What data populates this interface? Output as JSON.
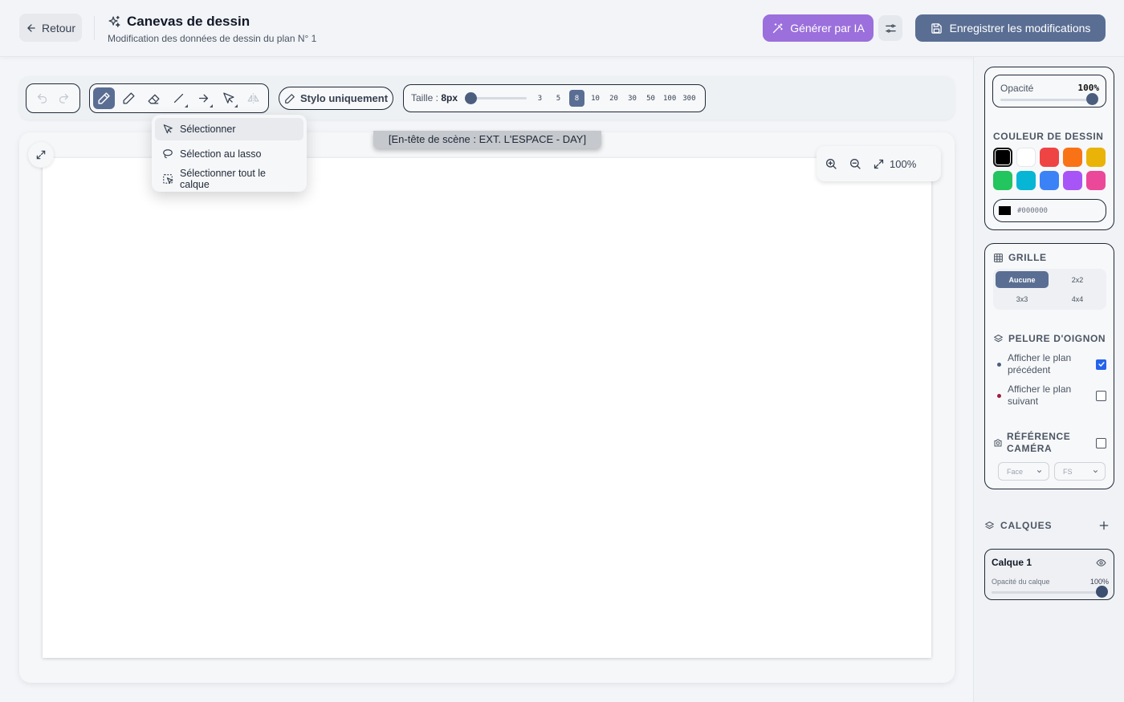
{
  "header": {
    "back_label": "Retour",
    "title": "Canevas de dessin",
    "subtitle": "Modification des données de dessin du plan N° 1",
    "ai_button": "Générer par IA",
    "save_button": "Enregistrer les modifications"
  },
  "toolbar": {
    "pen_only": "Stylo uniquement",
    "size_label": "Taille :",
    "size_value": "8px",
    "size_slider_fraction": 0.0,
    "presets": [
      "3",
      "5",
      "8",
      "10",
      "20",
      "30",
      "50",
      "100",
      "300"
    ],
    "active_preset": "8"
  },
  "select_menu": {
    "items": [
      "Sélectionner",
      "Sélection au lasso",
      "Sélectionner tout le calque"
    ]
  },
  "canvas": {
    "scene_header": "[En-tête de scène : EXT. L'ESPACE - DAY]",
    "zoom": "100%"
  },
  "panel": {
    "opacity_label": "Opacité",
    "opacity_value": "100%",
    "color_title": "COULEUR DE DESSIN",
    "colors": [
      "#000000",
      "#ffffff",
      "#ef4444",
      "#f97316",
      "#eab308",
      "#22c55e",
      "#06b6d4",
      "#3b82f6",
      "#a855f7",
      "#ec4899"
    ],
    "selected_color": "#000000",
    "hex_value": "#000000",
    "grid_title": "GRILLE",
    "grid_options": [
      "Aucune",
      "2x2",
      "3x3",
      "4x4"
    ],
    "grid_selected": "Aucune",
    "onion_title": "PELURE D'OIGNON",
    "onion_prev": "Afficher le plan précédent",
    "onion_prev_checked": true,
    "onion_next": "Afficher le plan suivant",
    "onion_next_checked": false,
    "camera_title": "RÉFÉRENCE CAMÉRA",
    "camera_checked": false,
    "camera_angle": "Face",
    "camera_shot": "FS",
    "layers_title": "CALQUES",
    "layer_name": "Calque 1",
    "layer_opacity_label": "Opacité du calque",
    "layer_opacity_value": "100%"
  }
}
